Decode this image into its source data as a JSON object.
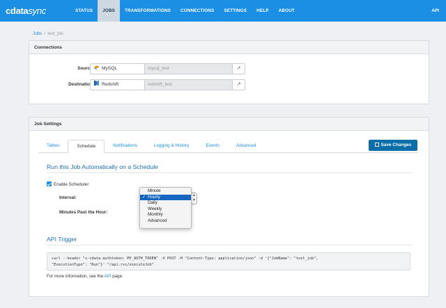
{
  "app": {
    "logo_text": "cdata",
    "logo_suffix": "sync"
  },
  "nav": {
    "items": [
      {
        "label": "STATUS",
        "active": false
      },
      {
        "label": "JOBS",
        "active": true
      },
      {
        "label": "TRANSFORMATIONS",
        "active": false
      },
      {
        "label": "CONNECTIONS",
        "active": false
      },
      {
        "label": "SETTINGS",
        "active": false
      },
      {
        "label": "HELP",
        "active": false
      },
      {
        "label": "ABOUT",
        "active": false
      }
    ],
    "api_label": "API"
  },
  "breadcrumb": {
    "root": "Jobs",
    "separator": "/",
    "current": "test_job"
  },
  "connections": {
    "title": "Connections",
    "source": {
      "label": "Source:",
      "type": "MySQL",
      "value": "mysql_test",
      "icon": "mysql-dolphin-icon"
    },
    "destination": {
      "label": "Destination:",
      "type": "Redshift",
      "value": "redshift_test",
      "icon": "redshift-icon"
    },
    "external_icon": "↗"
  },
  "job_settings": {
    "title": "Job Settings",
    "tabs": [
      {
        "label": "Tables",
        "active": false
      },
      {
        "label": "Schedule",
        "active": true
      },
      {
        "label": "Notifications",
        "active": false
      },
      {
        "label": "Logging & History",
        "active": false
      },
      {
        "label": "Events",
        "active": false
      },
      {
        "label": "Advanced",
        "active": false
      }
    ],
    "save_label": "Save Changes",
    "schedule": {
      "title": "Run this Job Automatically on a Schedule",
      "enable_label": "Enable Scheduler",
      "enabled": true,
      "interval_label": "Interval:",
      "minutes_label": "Minutes Past the Hour:",
      "interval_options": [
        "Minute",
        "Hourly",
        "Daily",
        "Weekly",
        "Monthly",
        "Advanced"
      ],
      "interval_selected": "Hourly"
    },
    "api_trigger": {
      "title": "API Trigger",
      "code_line1": "curl --header \"x-cdata-authtoken: MY_AUTH_TOKEN\" -X POST -H \"Content-Type: application/json\" -d '{\"JobName\": \"test_job\",",
      "code_line2": "\"ExecutionType\": \"Run\"}' \"/api.rsc/executeJob\"",
      "info_prefix": "For more information, see the",
      "info_link": "API",
      "info_suffix": "page."
    }
  },
  "colors": {
    "brand": "#1a8fe3",
    "save_button": "#0a6ea8",
    "selected_option": "#1565c0"
  }
}
